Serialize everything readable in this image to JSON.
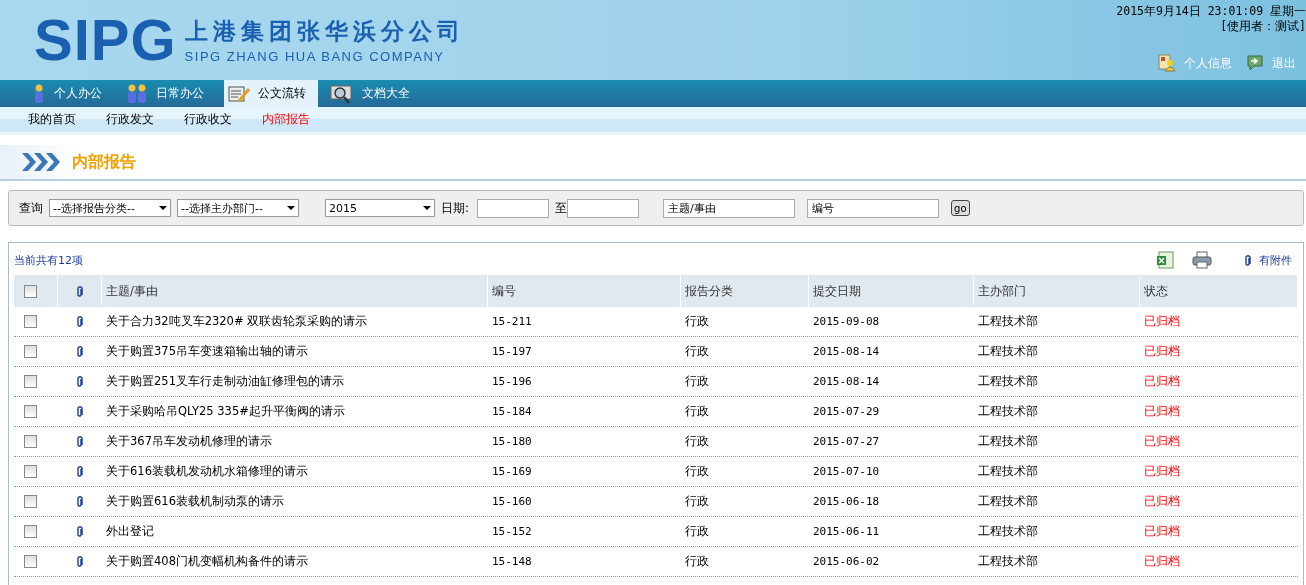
{
  "header": {
    "logo": "SIPG",
    "company_name": "上港集团张华浜分公司",
    "company_name_en": "SIPG ZHANG HUA BANG COMPANY",
    "datetime": "2015年9月14日 23:01:09 星期一",
    "user": "[使用者：测试]",
    "links": [
      {
        "label": "个人信息",
        "kind": "profile"
      },
      {
        "label": "退出",
        "kind": "logout"
      }
    ]
  },
  "nav_tabs": [
    {
      "label": "个人办公",
      "kind": "person",
      "selected": false
    },
    {
      "label": "日常办公",
      "kind": "people",
      "selected": false
    },
    {
      "label": "公文流转",
      "kind": "document",
      "selected": true
    },
    {
      "label": "文档大全",
      "kind": "search",
      "selected": false
    }
  ],
  "sub_nav": [
    {
      "label": "我的首页",
      "selected": false
    },
    {
      "label": "行政发文",
      "selected": false
    },
    {
      "label": "行政收文",
      "selected": false
    },
    {
      "label": "内部报告",
      "selected": true
    }
  ],
  "page_title": "内部报告",
  "filter": {
    "label": "查询",
    "selects": [
      {
        "value": "--选择报告分类--",
        "kind": "narrow"
      },
      {
        "value": "--选择主办部门--",
        "kind": "narrow"
      },
      {
        "value": "2015",
        "kind": "wide"
      }
    ],
    "date_label": "日期:",
    "date_to": "至",
    "subject_value": "主题/事由",
    "number_value": "编号",
    "go": "go"
  },
  "table": {
    "count": "当前共有12项",
    "attachment_legend": "有附件",
    "select_all_checked": false,
    "columns": [
      "主题/事由",
      "编号",
      "报告分类",
      "提交日期",
      "主办部门",
      "状态"
    ],
    "rows": [
      {
        "checked": false,
        "subject": "关于合力32吨叉车2320# 双联齿轮泵采购的请示",
        "number": "15-211",
        "category": "行政",
        "date": "2015-09-08",
        "department": "工程技术部",
        "status": "已归档"
      },
      {
        "checked": false,
        "subject": "关于购置375吊车变速箱输出轴的请示",
        "number": "15-197",
        "category": "行政",
        "date": "2015-08-14",
        "department": "工程技术部",
        "status": "已归档"
      },
      {
        "checked": false,
        "subject": "关于购置251叉车行走制动油缸修理包的请示",
        "number": "15-196",
        "category": "行政",
        "date": "2015-08-14",
        "department": "工程技术部",
        "status": "已归档"
      },
      {
        "checked": false,
        "subject": "关于采购哈吊QLY25 335#起升平衡阀的请示",
        "number": "15-184",
        "category": "行政",
        "date": "2015-07-29",
        "department": "工程技术部",
        "status": "已归档"
      },
      {
        "checked": false,
        "subject": "关于367吊车发动机修理的请示",
        "number": "15-180",
        "category": "行政",
        "date": "2015-07-27",
        "department": "工程技术部",
        "status": "已归档"
      },
      {
        "checked": false,
        "subject": "关于616装载机发动机水箱修理的请示",
        "number": "15-169",
        "category": "行政",
        "date": "2015-07-10",
        "department": "工程技术部",
        "status": "已归档"
      },
      {
        "checked": false,
        "subject": "关于购置616装载机制动泵的请示",
        "number": "15-160",
        "category": "行政",
        "date": "2015-06-18",
        "department": "工程技术部",
        "status": "已归档"
      },
      {
        "checked": false,
        "subject": "外出登记",
        "number": "15-152",
        "category": "行政",
        "date": "2015-06-11",
        "department": "工程技术部",
        "status": "已归档"
      },
      {
        "checked": false,
        "subject": "关于购置408门机变幅机构备件的请示",
        "number": "15-148",
        "category": "行政",
        "date": "2015-06-02",
        "department": "工程技术部",
        "status": "已归档"
      }
    ]
  }
}
